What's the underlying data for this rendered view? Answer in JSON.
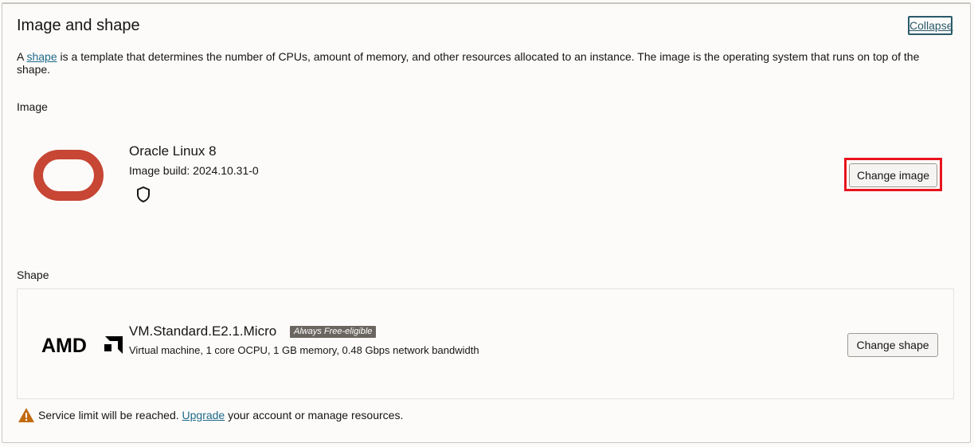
{
  "section": {
    "title": "Image and shape",
    "collapse_label": "Collapse",
    "description": {
      "prefix": "A ",
      "link": "shape",
      "suffix": " is a template that determines the number of CPUs, amount of memory, and other resources allocated to an instance. The image is the operating system that runs on top of the shape."
    }
  },
  "image": {
    "label": "Image",
    "name": "Oracle Linux 8",
    "build": "Image build: 2024.10.31-0",
    "change_button": "Change image",
    "logo_icon": "oracle-logo-icon",
    "security_icon": "shield-icon"
  },
  "shape": {
    "label": "Shape",
    "name": "VM.Standard.E2.1.Micro",
    "badge": "Always Free-eligible",
    "description": "Virtual machine, 1 core OCPU, 1 GB memory, 0.48 Gbps network bandwidth",
    "change_button": "Change shape",
    "vendor_logo": "AMD",
    "vendor_logo_icon": "amd-logo-icon"
  },
  "notice": {
    "prefix": "Service limit will be reached. ",
    "link": "Upgrade",
    "suffix": " your account or manage resources.",
    "icon": "warning-icon"
  },
  "colors": {
    "oracle_red": "#c74634",
    "highlight": "#e8141e",
    "link": "#1f6a8a",
    "badge_bg": "#6a655f",
    "warning": "#c26a0f"
  }
}
